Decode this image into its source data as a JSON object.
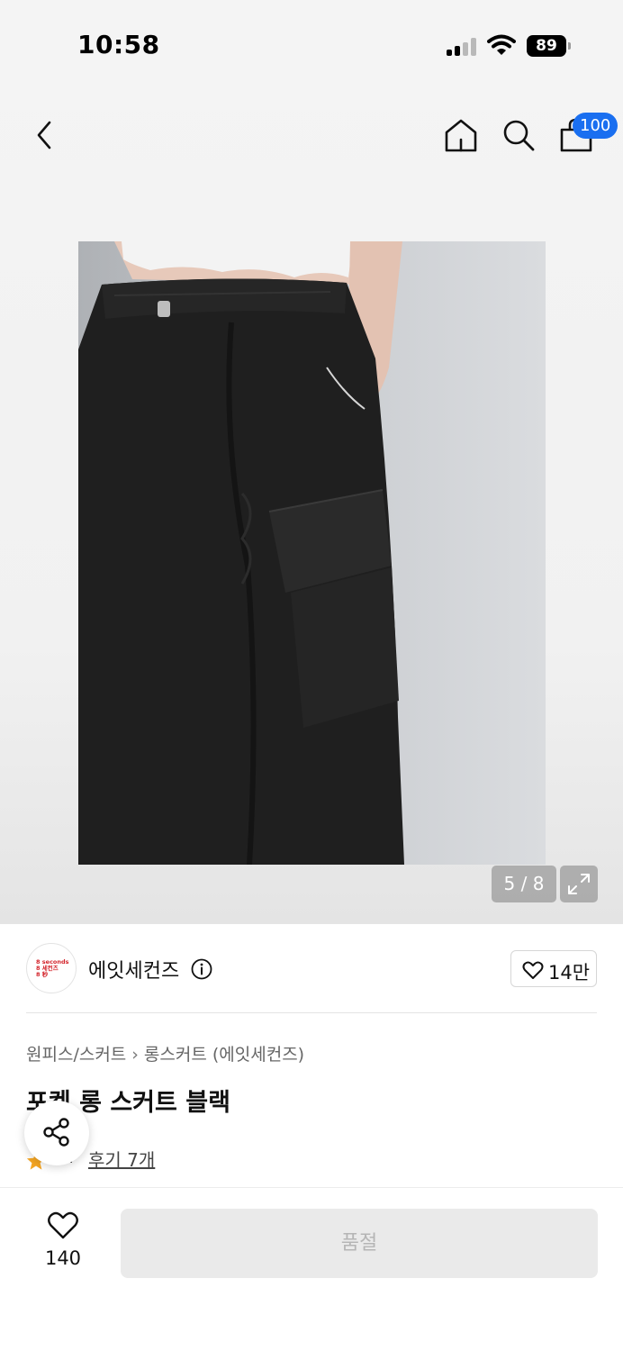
{
  "status_bar": {
    "time": "10:58",
    "battery": "89"
  },
  "header": {
    "cart_count": "100"
  },
  "gallery": {
    "counter": "5 / 8"
  },
  "brand": {
    "name": "에잇세컨즈",
    "logo_lines": [
      "8 seconds",
      "8 세컨즈",
      "8 秒"
    ],
    "like_count": "14만"
  },
  "breadcrumb": {
    "level1": "원피스/스커트",
    "separator": "›",
    "level2": "롱스커트 (에잇세컨즈)"
  },
  "product": {
    "title": "포켓 롱 스커트 블랙",
    "rating": "../",
    "reviews": "후기 7개"
  },
  "bottom_bar": {
    "wish_count": "140",
    "buy_label": "품절"
  },
  "colors": {
    "accent": "#1a6ff0",
    "brand_red": "#d3232a",
    "star": "#f5a623"
  }
}
